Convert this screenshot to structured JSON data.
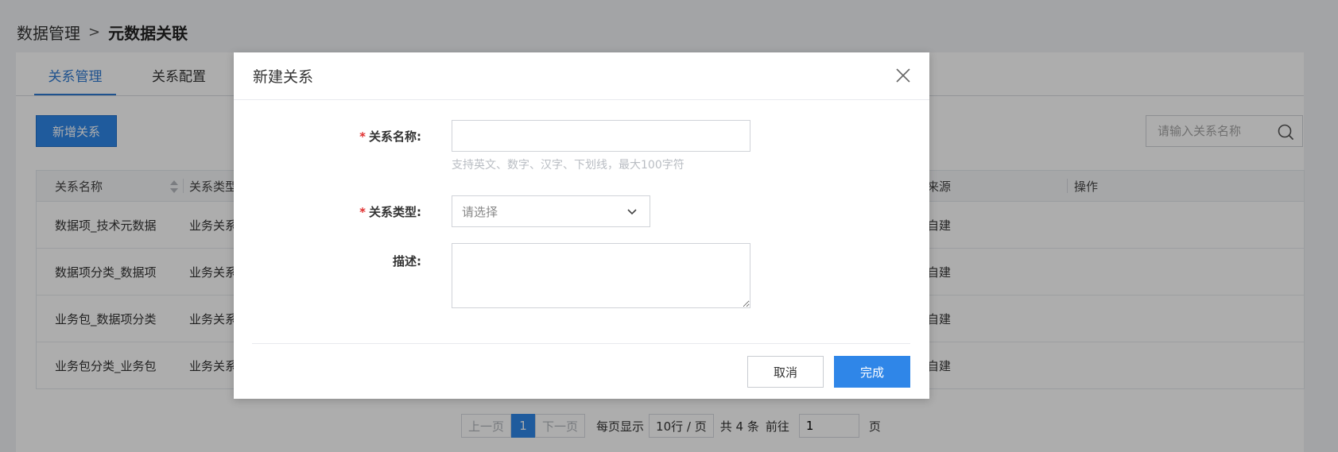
{
  "breadcrumb": {
    "root": "数据管理",
    "separator": ">",
    "current": "元数据关联"
  },
  "tabs": [
    {
      "label": "关系管理",
      "active": true
    },
    {
      "label": "关系配置",
      "active": false
    }
  ],
  "toolbar": {
    "add_label": "新增关系",
    "search_placeholder": "请输入关系名称"
  },
  "table": {
    "headers": {
      "name": "关系名称",
      "type": "关系类型",
      "source": "来源",
      "ops": "操作"
    },
    "rows": [
      {
        "name": "数据项_技术元数据",
        "type": "业务关系",
        "source": "自建"
      },
      {
        "name": "数据项分类_数据项",
        "type": "业务关系",
        "source": "自建"
      },
      {
        "name": "业务包_数据项分类",
        "type": "业务关系",
        "source": "自建"
      },
      {
        "name": "业务包分类_业务包",
        "type": "业务关系",
        "source": "自建"
      }
    ]
  },
  "pagination": {
    "prev": "上一页",
    "current": "1",
    "next": "下一页",
    "per_page_label": "每页显示",
    "page_size": "10行 / 页",
    "total": "共 4 条",
    "goto_label": "前往",
    "goto_value": "1",
    "page_unit": "页"
  },
  "dialog": {
    "title": "新建关系",
    "name_label": "关系名称:",
    "name_hint": "支持英文、数字、汉字、下划线，最大100字符",
    "type_label": "关系类型:",
    "type_placeholder": "请选择",
    "desc_label": "描述:",
    "required_mark": "*",
    "cancel_label": "取消",
    "ok_label": "完成"
  },
  "colors": {
    "primary": "#2f86e8",
    "required": "#e03131",
    "mask": "rgba(0,0,0,0.32)"
  },
  "icons": {
    "search": "search-icon",
    "close": "close-icon",
    "dropdown": "chevron-down-icon",
    "sort": "sort-icon"
  }
}
